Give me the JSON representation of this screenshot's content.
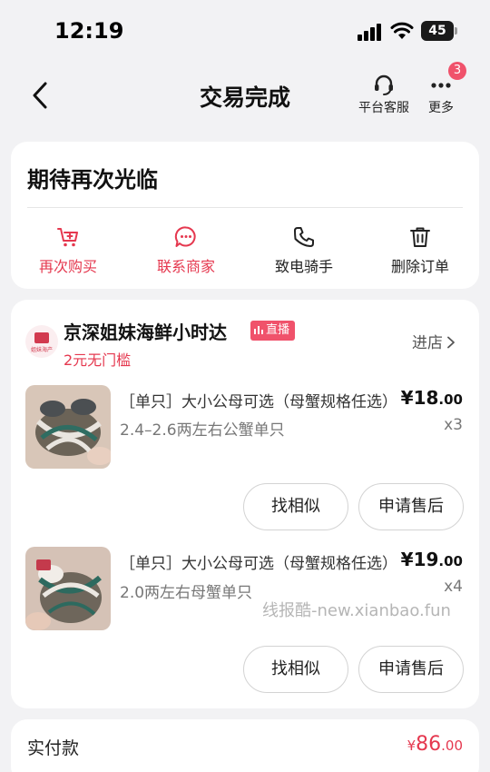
{
  "status_bar": {
    "time": "12:19",
    "battery": "45"
  },
  "nav": {
    "title": "交易完成",
    "customer_service": "平台客服",
    "more": "更多",
    "more_badge": "3"
  },
  "status_card": {
    "message": "期待再次光临",
    "actions": [
      {
        "label": "再次购买",
        "icon": "cart-plus-icon"
      },
      {
        "label": "联系商家",
        "icon": "chat-bubble-icon"
      },
      {
        "label": "致电骑手",
        "icon": "phone-icon"
      },
      {
        "label": "删除订单",
        "icon": "trash-icon"
      }
    ]
  },
  "shop": {
    "logo_text": "姐妹海产",
    "name": "京深姐妹海鲜小时达",
    "live_label": "直播",
    "coupon": "2元无门槛",
    "enter_label": "进店"
  },
  "products": [
    {
      "title": "［单只］大小公母可选（母蟹规格任选）",
      "spec": "2.4–2.6两左右公蟹单只",
      "price_currency": "¥",
      "price_int": "18",
      "price_dec": ".00",
      "qty": "x3",
      "similar_label": "找相似",
      "after_sale_label": "申请售后"
    },
    {
      "title": "［单只］大小公母可选（母蟹规格任选）",
      "spec": "2.0两左右母蟹单只",
      "price_currency": "¥",
      "price_int": "19",
      "price_dec": ".00",
      "qty": "x4",
      "similar_label": "找相似",
      "after_sale_label": "申请售后"
    }
  ],
  "watermark": "线报酷-new.xianbao.fun",
  "payment": {
    "label": "实付款",
    "currency": "¥",
    "amount_int": "86",
    "amount_dec": ".00"
  },
  "colors": {
    "accent": "#e5384f",
    "badge": "#f0526b",
    "background": "#f2f2f4"
  }
}
